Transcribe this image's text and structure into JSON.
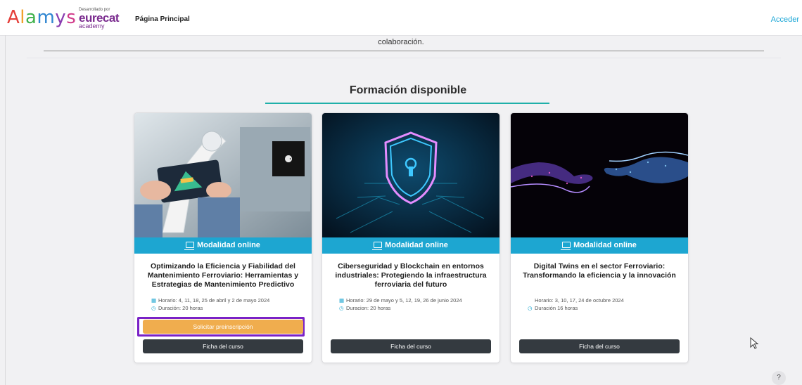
{
  "header": {
    "logo_text": [
      "A",
      "l",
      "a",
      "m",
      "y",
      "s"
    ],
    "partner_pre": "Desarrollado por",
    "partner_main": "eurecat",
    "partner_sub": "academy",
    "nav_home": "Página Principal",
    "login": "Acceder"
  },
  "intro": {
    "text": "colaboración."
  },
  "section": {
    "title": "Formación disponible"
  },
  "cards": [
    {
      "modality": "Modalidad online",
      "title": "Optimizando la Eficiencia y Fiabilidad del Mantenimiento Ferroviario: Herramientas y Estrategias de Mantenimiento Predictivo",
      "schedule": "Horario: 4, 11, 18, 25 de abril  y 2 de mayo 2024",
      "duration": "Duración: 20 horas",
      "primary_button": "Solicitar preinscripción",
      "secondary_button": "Ficha del curso"
    },
    {
      "modality": "Modalidad online",
      "title": "Ciberseguridad y Blockchain en entornos industriales: Protegiendo la infraestructura ferroviaria del futuro",
      "schedule": "Horario: 29 de mayo y 5, 12, 19, 26 de junio 2024",
      "duration": "Duracion: 20 horas",
      "secondary_button": "Ficha del curso"
    },
    {
      "modality": "Modalidad online",
      "title": "Digital Twins en el sector Ferroviario: Transformando la eficiencia y la innovación",
      "schedule": "Horario: 3, 10, 17, 24 de octubre 2024",
      "duration": "Duración 16 horas",
      "secondary_button": "Ficha del curso"
    }
  ],
  "help": {
    "label": "?"
  },
  "colors": {
    "accent": "#1da6d1",
    "primary_button": "#f0ad4e",
    "dark_button": "#343a40",
    "highlight": "#7a22c7",
    "underline": "#1fb0a9"
  }
}
